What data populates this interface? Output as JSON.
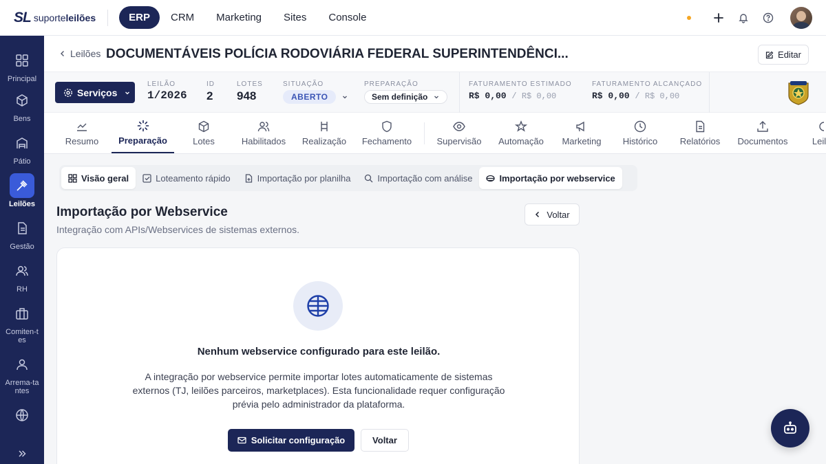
{
  "brand": {
    "mark": "SL",
    "name_regular": "suporte",
    "name_bold": "leilões"
  },
  "topnav": [
    {
      "label": "ERP",
      "active": true
    },
    {
      "label": "CRM",
      "active": false
    },
    {
      "label": "Marketing",
      "active": false
    },
    {
      "label": "Sites",
      "active": false
    },
    {
      "label": "Console",
      "active": false
    }
  ],
  "sidebar": {
    "items": [
      {
        "label": "Principal",
        "icon": "grid-icon"
      },
      {
        "label": "Bens",
        "icon": "box-icon"
      },
      {
        "label": "Pátio",
        "icon": "warehouse-icon"
      },
      {
        "label": "Leilões",
        "icon": "gavel-icon",
        "active": true
      },
      {
        "label": "Gestão",
        "icon": "document-icon"
      },
      {
        "label": "RH",
        "icon": "users-icon"
      },
      {
        "label": "Comiten-tes",
        "icon": "briefcase-icon"
      },
      {
        "label": "Arrema-tantes",
        "icon": "user-icon"
      },
      {
        "label": "",
        "icon": "globe-icon"
      }
    ]
  },
  "header": {
    "back_label": "Leilões",
    "title": "DOCUMENTÁVEIS POLÍCIA RODOVIÁRIA FEDERAL SUPERINTENDÊNCI...",
    "edit_label": "Editar"
  },
  "info": {
    "services_label": "Serviços",
    "leilao_key": "LEILÃO",
    "leilao_val": "1/2026",
    "id_key": "ID",
    "id_val": "2",
    "lotes_key": "LOTES",
    "lotes_val": "948",
    "situacao_key": "SITUAÇÃO",
    "situacao_val": "ABERTO",
    "preparacao_key": "PREPARAÇÃO",
    "preparacao_val": "Sem definição",
    "fat_est_key": "FATURAMENTO ESTIMADO",
    "fat_est_val": "R$ 0,00",
    "fat_est_sec": "/ R$ 0,00",
    "fat_alc_key": "FATURAMENTO ALCANÇADO",
    "fat_alc_val": "R$ 0,00",
    "fat_alc_sec": "/ R$ 0,00"
  },
  "modtabs": [
    {
      "label": "Resumo",
      "icon": "chart-line-icon"
    },
    {
      "label": "Preparação",
      "icon": "loader-icon",
      "active": true
    },
    {
      "label": "Lotes",
      "icon": "box-icon"
    },
    {
      "label": "Habilitados",
      "icon": "users-icon"
    },
    {
      "label": "Realização",
      "icon": "gavel-icon"
    },
    {
      "label": "Fechamento",
      "icon": "shield-icon"
    },
    {
      "label": "Supervisão",
      "icon": "eye-icon"
    },
    {
      "label": "Automação",
      "icon": "star-icon"
    },
    {
      "label": "Marketing",
      "icon": "megaphone-icon"
    },
    {
      "label": "Histórico",
      "icon": "clock-icon"
    },
    {
      "label": "Relatórios",
      "icon": "file-text-icon"
    },
    {
      "label": "Documentos",
      "icon": "upload-icon"
    },
    {
      "label": "Leil",
      "icon": "partial-icon"
    }
  ],
  "subtabs": [
    {
      "label": "Visão geral",
      "icon": "grid-icon"
    },
    {
      "label": "Loteamento rápido",
      "icon": "check-square-icon"
    },
    {
      "label": "Importação por planilha",
      "icon": "file-plus-icon"
    },
    {
      "label": "Importação com análise",
      "icon": "search-icon"
    },
    {
      "label": "Importação por webservice",
      "icon": "webservice-icon",
      "active": true
    }
  ],
  "content": {
    "title": "Importação por Webservice",
    "subtitle": "Integração com APIs/Webservices de sistemas externos.",
    "back_button": "Voltar",
    "empty_title": "Nenhum webservice configurado para este leilão.",
    "empty_desc": "A integração por webservice permite importar lotes automaticamente de sistemas externos (TJ, leilões parceiros, marketplaces). Esta funcionalidade requer configuração prévia pelo administrador da plataforma.",
    "request_button": "Solicitar configuração",
    "voltar_button": "Voltar"
  },
  "colors": {
    "primary": "#1c2657",
    "accent": "#3a5bd9",
    "notification_dot": "#f5a623"
  }
}
